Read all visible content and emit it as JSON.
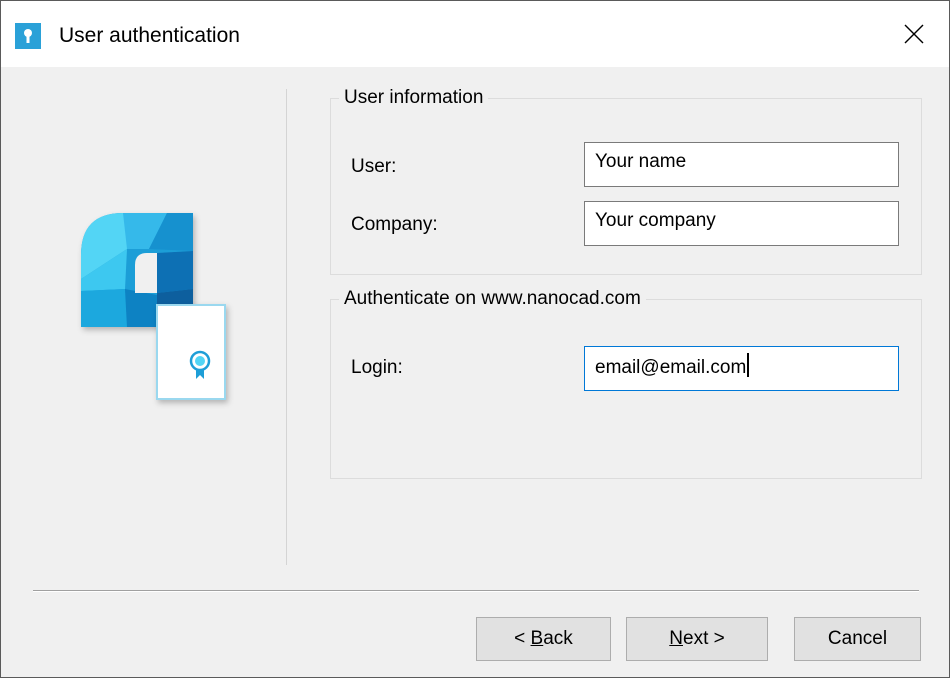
{
  "window": {
    "title": "User authentication",
    "title_icon": "lock-icon",
    "close_icon": "close-icon"
  },
  "logo": {
    "icon": "nanocad-certificate-logo",
    "colors": [
      "#1e9ed7",
      "#53d5f5",
      "#0d6fb4",
      "#9ad8ef"
    ]
  },
  "user_info": {
    "legend": "User information",
    "user_label": "User:",
    "user_value": "Your name",
    "company_label": "Company:",
    "company_value": "Your company"
  },
  "auth": {
    "legend": "Authenticate on www.nanocad.com",
    "login_label": "Login:",
    "login_value": "email@email.com"
  },
  "buttons": {
    "back_prefix": "< ",
    "back_mnemonic": "B",
    "back_rest": "ack",
    "next_mnemonic": "N",
    "next_rest": "ext >",
    "cancel": "Cancel"
  },
  "colors": {
    "focus_border": "#0078d7",
    "dialog_bg": "#f0f0f0",
    "button_bg": "#e1e1e1"
  }
}
